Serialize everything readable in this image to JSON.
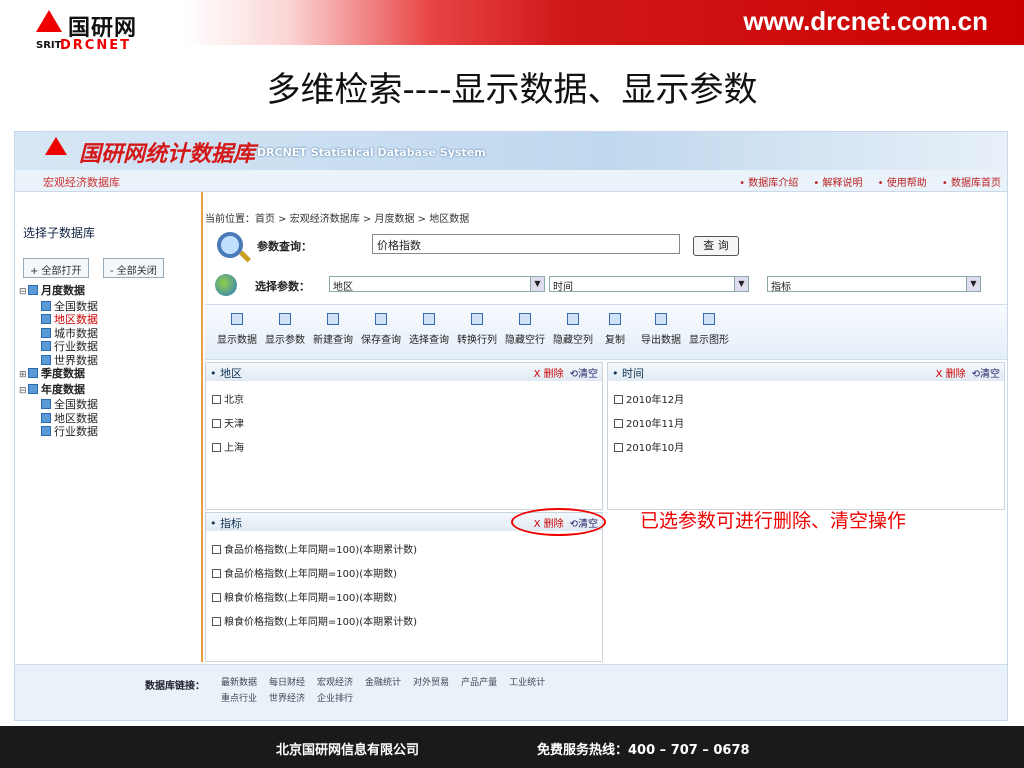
{
  "header": {
    "logo_cn": "国研网",
    "logo_en1": "SRIT",
    "logo_en2": "DRCNET",
    "site": "www.drcnet.com.cn"
  },
  "slide_title": "多维检索----显示数据、显示参数",
  "app": {
    "title_cn": "国研网统计数据库",
    "title_en": "DRCNET Statistical Database System",
    "db_name": "宏观经济数据库",
    "top_links": [
      "• 数据库介绍",
      "• 解释说明",
      "• 使用帮助",
      "• 数据库首页"
    ]
  },
  "sidebar": {
    "select_label": "选择子数据库",
    "open_all": "+ 全部打开",
    "close_all": "- 全部关闭",
    "tree": [
      {
        "label": "月度数据",
        "children": [
          "全国数据",
          "地区数据",
          "城市数据",
          "行业数据",
          "世界数据"
        ]
      },
      {
        "label": "季度数据",
        "children": []
      },
      {
        "label": "年度数据",
        "children": [
          "全国数据",
          "地区数据",
          "行业数据"
        ]
      }
    ]
  },
  "main": {
    "breadcrumb": "当前位置：首页 > 宏观经济数据库 > 月度数据 > 地区数据",
    "query_label": "参数查询：",
    "query_value": "价格指数",
    "query_button": "查 询",
    "param_label": "选择参数：",
    "selects": [
      "地区",
      "时间",
      "指标"
    ],
    "toolbar": [
      "显示数据",
      "显示参数",
      "新建查询",
      "保存查询",
      "选择查询",
      "转换行列",
      "隐藏空行",
      "隐藏空列",
      "复制",
      "导出数据",
      "显示图形"
    ],
    "panels": {
      "region": {
        "title": "• 地区",
        "items": [
          "北京",
          "天津",
          "上海"
        ]
      },
      "time": {
        "title": "• 时间",
        "items": [
          "2010年12月",
          "2010年11月",
          "2010年10月"
        ]
      },
      "indicator": {
        "title": "• 指标",
        "items": [
          "食品价格指数(上年同期=100)(本期累计数)",
          "食品价格指数(上年同期=100)(本期数)",
          "粮食价格指数(上年同期=100)(本期数)",
          "粮食价格指数(上年同期=100)(本期累计数)"
        ]
      }
    },
    "delete_label": "X 删除",
    "clear_label": "清空"
  },
  "annotation": "已选参数可进行删除、清空操作",
  "footer_links": {
    "label": "数据库链接：",
    "row1": [
      "最新数据",
      "每日财经",
      "宏观经济",
      "金融统计",
      "对外贸易",
      "产品产量",
      "工业统计"
    ],
    "row2": [
      "重点行业",
      "世界经济",
      "企业排行"
    ]
  },
  "bottom": {
    "company": "北京国研网信息有限公司",
    "hotline": "免费服务热线：400 – 707 – 0678"
  }
}
